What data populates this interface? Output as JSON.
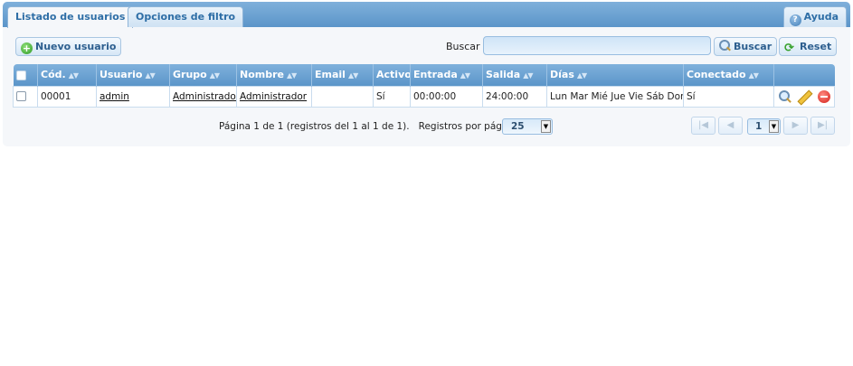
{
  "tabs": [
    {
      "label": "Listado de usuarios"
    },
    {
      "label": "Opciones de filtro"
    }
  ],
  "help": {
    "label": "Ayuda",
    "icon": "help-icon"
  },
  "toolbar": {
    "new_user": "Nuevo usuario",
    "search_label": "Buscar",
    "search_value": "",
    "search_button": "Buscar",
    "reset_button": "Reset"
  },
  "columns": [
    "Cód.",
    "Usuario",
    "Grupo",
    "Nombre",
    "Email",
    "Activo",
    "Entrada",
    "Salida",
    "Días",
    "Conectado"
  ],
  "rows": [
    {
      "cod": "00001",
      "usuario": "admin",
      "grupo": "Administrador",
      "nombre": "Administrador",
      "email": "",
      "activo": "Sí",
      "entrada": "00:00:00",
      "salida": "24:00:00",
      "dias": "Lun Mar Mié Jue Vie Sáb Dom",
      "conectado": "Sí"
    }
  ],
  "pager": {
    "summary": "Página 1 de 1 (registros del 1 al 1 de 1).",
    "per_page_label": "Registros por página:",
    "per_page": "25",
    "current_page": "1"
  },
  "colors": {
    "header_blue": "#5b95c9",
    "tab_text": "#2e6ea6",
    "panel_bg": "#f5f7fa"
  }
}
